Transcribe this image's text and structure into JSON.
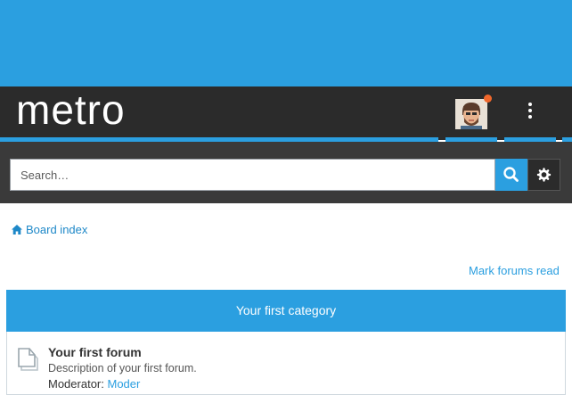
{
  "header": {
    "brand": "metro",
    "colors": {
      "accent": "#2b9fe0",
      "nav_bg": "#2b2b2b",
      "notification": "#f0672b"
    },
    "avatar_icon": "user-avatar-bearded",
    "menu_icon": "vertical-dots-icon"
  },
  "search": {
    "placeholder": "Search…",
    "search_icon": "search-icon",
    "advanced_icon": "gear-icon"
  },
  "breadcrumb": {
    "home_icon": "home-icon",
    "label": "Board index"
  },
  "actions": {
    "mark_read": "Mark forums read"
  },
  "category": {
    "title": "Your first category",
    "forums": [
      {
        "title": "Your first forum",
        "description": "Description of your first forum.",
        "moderator_label": "Moderator:",
        "moderator_name": "Moder",
        "icon": "forum-read-icon"
      }
    ]
  }
}
